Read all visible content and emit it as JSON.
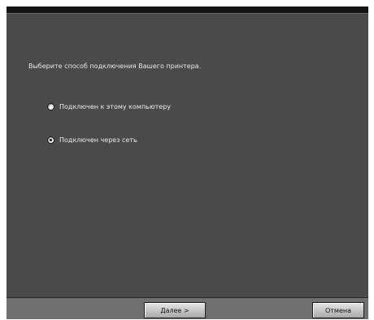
{
  "dialog": {
    "prompt": "Выберите способ подключения Вашего принтера."
  },
  "options": [
    {
      "label": "Подключен к этому компьютеру",
      "selected": false
    },
    {
      "label": "Подключен через сеть",
      "selected": true
    }
  ],
  "buttons": {
    "next_label": "Далее >",
    "cancel_label": "Отмена"
  },
  "colors": {
    "background": "#4a4a4a",
    "titlebar": "#151515",
    "footer": "#6f6f6f"
  }
}
